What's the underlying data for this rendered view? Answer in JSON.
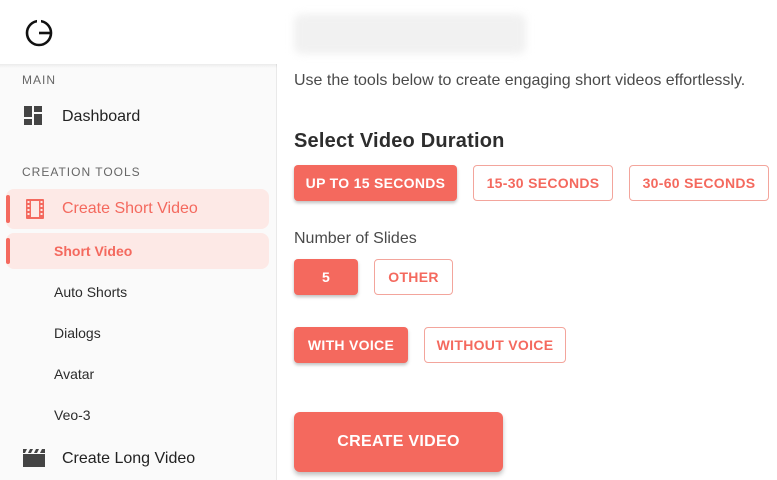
{
  "header": {
    "logo_icon": "power-circle-logo-icon"
  },
  "sidebar": {
    "section_main": "MAIN",
    "dashboard": {
      "label": "Dashboard",
      "icon": "dashboard-icon"
    },
    "section_creation": "CREATION TOOLS",
    "create_short": {
      "label": "Create Short Video",
      "icon": "film-strip-icon"
    },
    "sub_items": [
      {
        "label": "Short Video"
      },
      {
        "label": "Auto Shorts"
      },
      {
        "label": "Dialogs"
      },
      {
        "label": "Avatar"
      },
      {
        "label": "Veo-3"
      }
    ],
    "create_long": {
      "label": "Create Long Video",
      "icon": "clapperboard-icon"
    }
  },
  "main": {
    "intro": "Use the tools below to create engaging short videos effortlessly.",
    "duration_heading": "Select Video Duration",
    "duration_options": [
      "UP TO 15 SECONDS",
      "15-30 SECONDS",
      "30-60 SECONDS"
    ],
    "duration_selected": "UP TO 15 SECONDS",
    "slides_label": "Number of Slides",
    "slides_options": [
      "5",
      "OTHER"
    ],
    "slides_selected": "5",
    "voice_options": [
      "WITH VOICE",
      "WITHOUT VOICE"
    ],
    "voice_selected": "WITH VOICE",
    "create_button": "CREATE VIDEO"
  },
  "colors": {
    "accent": "#f4695e",
    "accent_light": "#fde9e6",
    "outline_border": "#f3a59c"
  }
}
